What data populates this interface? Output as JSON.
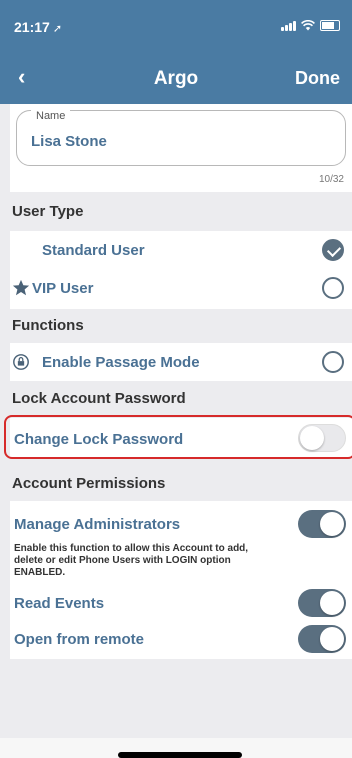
{
  "status_bar": {
    "time": "21:17",
    "location_arrow": "➚"
  },
  "nav": {
    "back_icon": "‹",
    "title": "Argo",
    "done_label": "Done"
  },
  "name_field": {
    "legend": "Name",
    "value": "Lisa Stone",
    "counter": "10/32"
  },
  "user_type": {
    "header": "User Type",
    "standard_label": "Standard User",
    "standard_selected": true,
    "vip_label": "VIP User",
    "vip_selected": false
  },
  "functions": {
    "header": "Functions",
    "passage_label": "Enable Passage Mode",
    "passage_selected": false
  },
  "lock_password": {
    "header": "Lock Account Password",
    "change_label": "Change Lock Password",
    "change_enabled": false
  },
  "permissions": {
    "header": "Account Permissions",
    "manage_admins_label": "Manage Administrators",
    "manage_admins_desc": "Enable this function to allow this Account to add, delete or edit Phone Users with LOGIN option ENABLED.",
    "manage_admins_enabled": true,
    "read_events_label": "Read Events",
    "read_events_enabled": true,
    "open_remote_label": "Open from remote",
    "open_remote_enabled": true
  },
  "colors": {
    "header_bg": "#4a7ba3",
    "label_blue": "#4a7194",
    "toggle_on": "#5a6f80",
    "highlight_red": "#d62a2a"
  }
}
